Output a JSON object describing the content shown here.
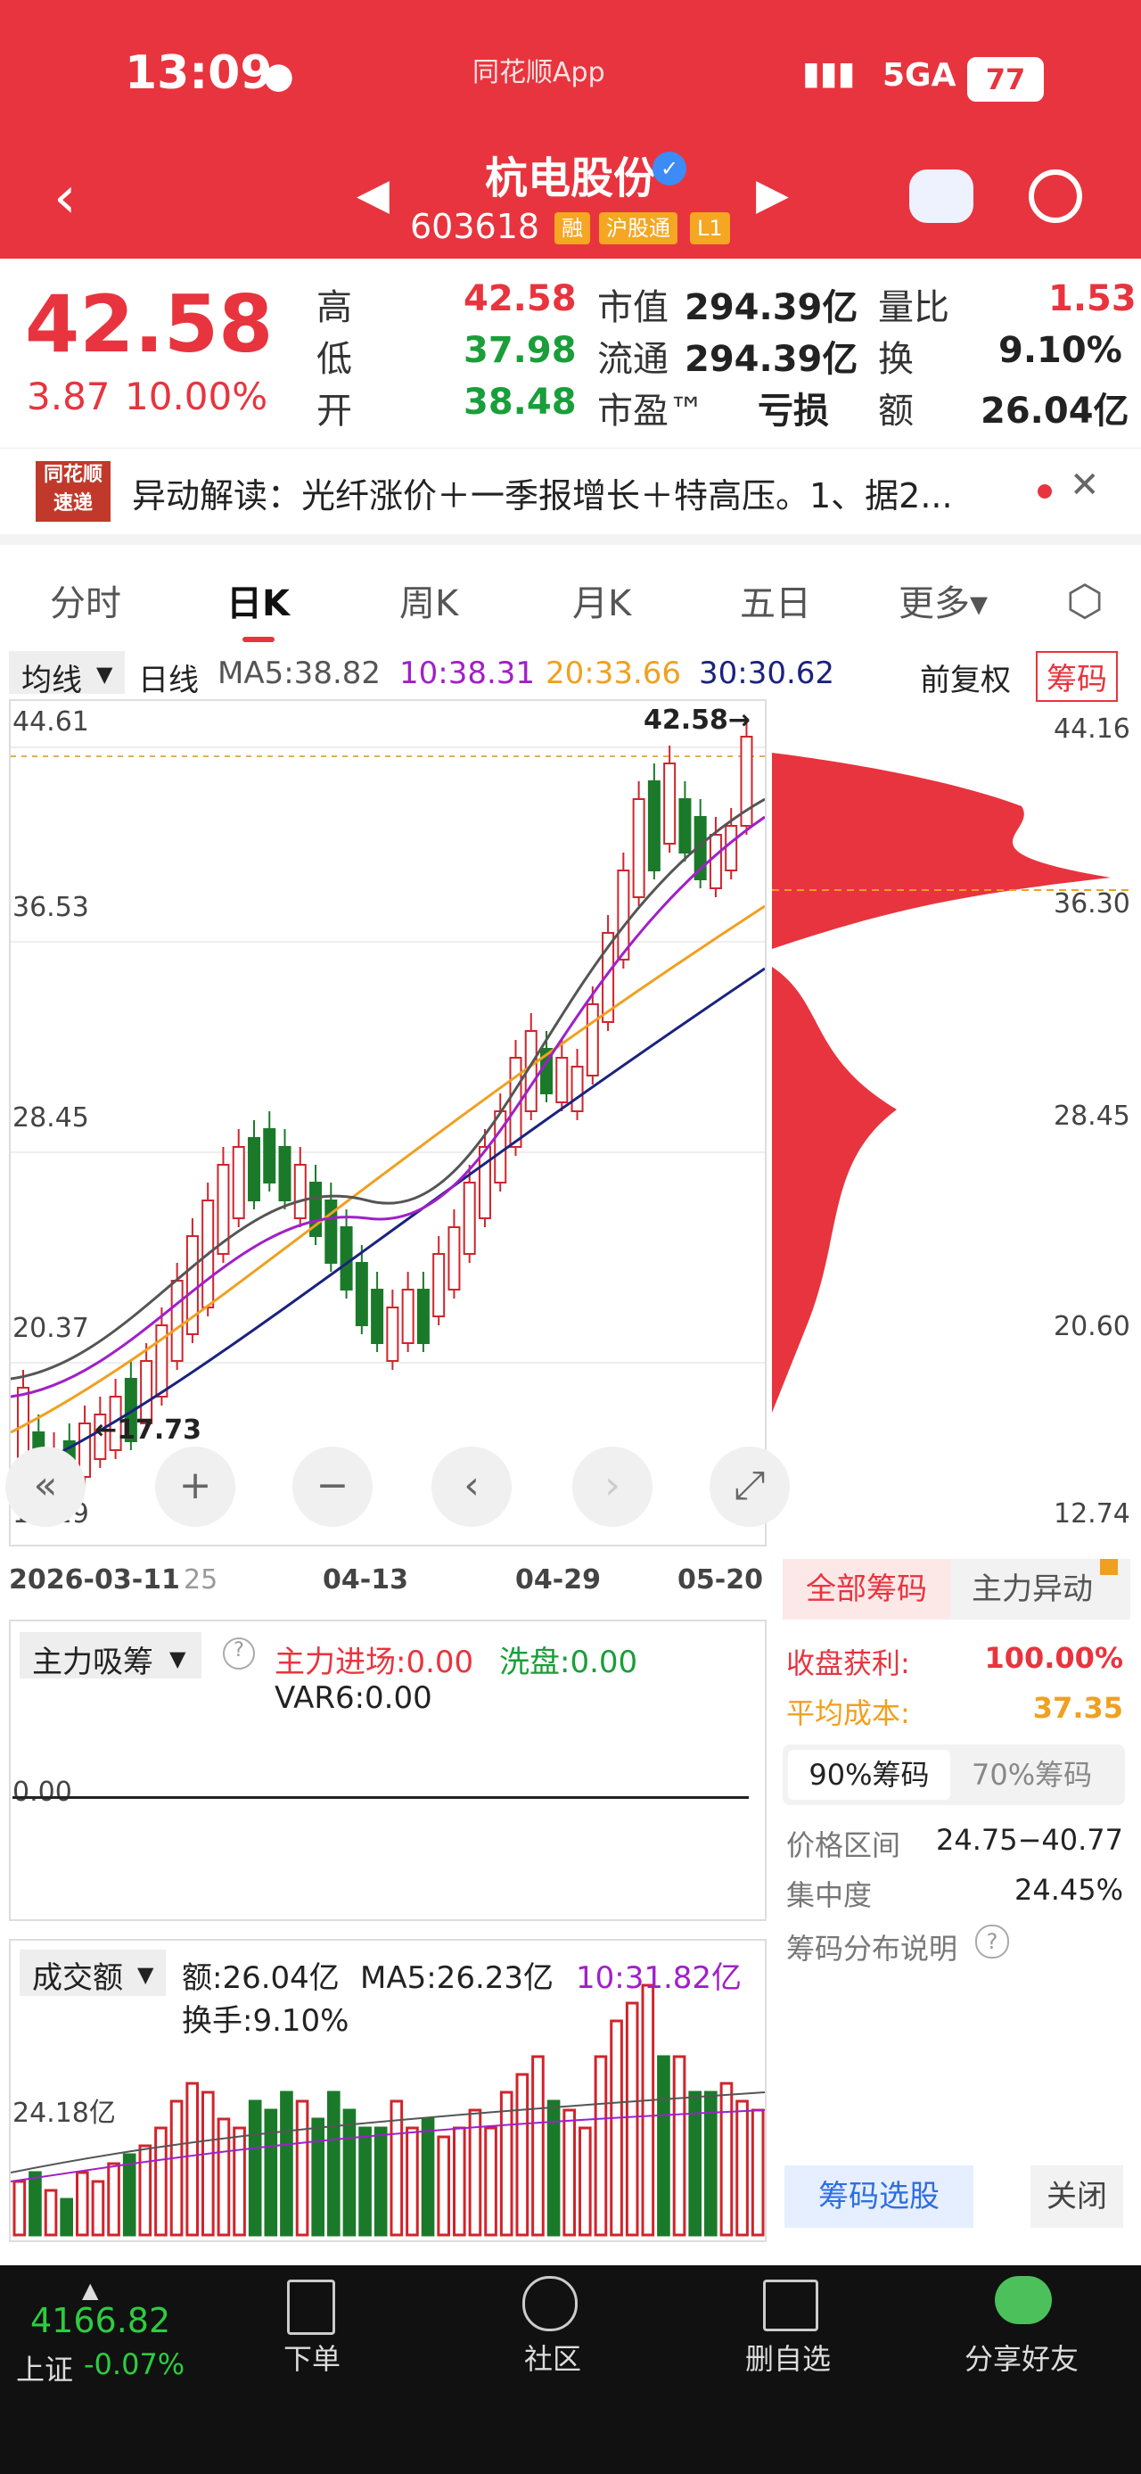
{
  "status": {
    "time": "13:09",
    "app": "同花顺App",
    "network": "5GA",
    "battery": "77"
  },
  "header": {
    "name": "杭电股份",
    "code": "603618",
    "tags": [
      "融",
      "沪股通",
      "L1"
    ]
  },
  "quote": {
    "price": "42.58",
    "change": "3.87",
    "change_pct": "10.00%",
    "high_label": "高",
    "high": "42.58",
    "low_label": "低",
    "low": "37.98",
    "open_label": "开",
    "open": "38.48",
    "mcap_label": "市值",
    "mcap": "294.39亿",
    "float_label": "流通",
    "float": "294.39亿",
    "pe_label": "市盈™",
    "pe": "亏损",
    "vr_label": "量比",
    "vr": "1.53",
    "turn_label": "换",
    "turn": "9.10%",
    "amt_label": "额",
    "amt": "26.04亿"
  },
  "news": {
    "brand": "同花顺速递",
    "text": "异动解读：光纤涨价＋一季报增长＋特高压。1、据2..."
  },
  "tabs": [
    "分时",
    "日K",
    "周K",
    "月K",
    "五日",
    "更多▾"
  ],
  "active_tab": "日K",
  "kline": {
    "indicator_select": "均线",
    "period": "日线",
    "ma5": "MA5:38.82",
    "ma10": "10:38.31",
    "ma20": "20:33.66",
    "ma30": "30:30.62",
    "adjust": "前复权",
    "chips_btn": "筹码",
    "y_labels": [
      "44.61",
      "36.53",
      "28.45",
      "20.37",
      "12.29"
    ],
    "high_mark": "42.58→",
    "low_mark": "←17.73",
    "dates": [
      "2026-03-11",
      "25",
      "04-13",
      "04-29",
      "05-20"
    ],
    "colors": {
      "ma5": "#555555",
      "ma10": "#a020c8",
      "ma20": "#f0a020",
      "ma30": "#1a237e",
      "up": "#d0242c",
      "down": "#1a7a2a"
    }
  },
  "chip": {
    "y_labels": [
      "44.16",
      "36.30",
      "28.45",
      "20.60",
      "12.74"
    ],
    "tab_all": "全部筹码",
    "tab_main": "主力异动",
    "profit_label": "收盘获利:",
    "profit": "100.00%",
    "avg_label": "平均成本:",
    "avg": "37.35",
    "seg_90": "90%筹码",
    "seg_70": "70%筹码",
    "range_label": "价格区间",
    "range": "24.75−40.77",
    "conc_label": "集中度",
    "conc": "24.45%",
    "note": "筹码分布说明",
    "select_btn": "筹码选股",
    "close_btn": "关闭"
  },
  "ind1": {
    "select": "主力吸筹",
    "inflow": "主力进场:0.00",
    "wash": "洗盘:0.00",
    "var6": "VAR6:0.00",
    "zero": "0.00"
  },
  "ind2": {
    "select": "成交额",
    "amount": "额:26.04亿",
    "ma5": "MA5:26.23亿",
    "ma10": "10:31.82亿",
    "turnover": "换手:9.10%",
    "ylabel": "24.18亿"
  },
  "bottom": {
    "index_value": "4166.82",
    "index_name": "上证",
    "index_chg": "-0.07%",
    "items": [
      "下单",
      "社区",
      "删自选",
      "分享好友"
    ]
  }
}
